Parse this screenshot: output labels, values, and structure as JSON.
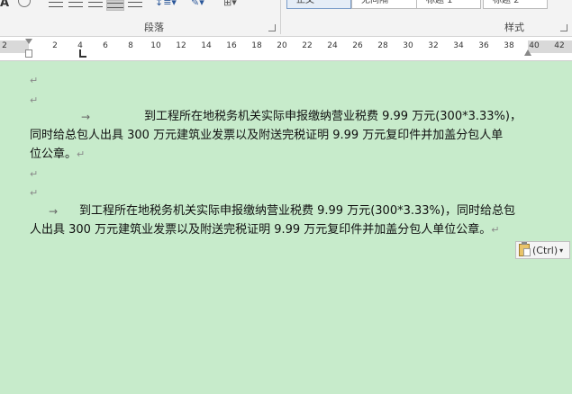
{
  "ribbon": {
    "paragraph_group_label": "段落",
    "styles_group_label": "样式",
    "style_items": [
      "正文",
      "无间隔",
      "标题 1",
      "标题 2"
    ]
  },
  "ruler": {
    "numbers": [
      "2",
      "2",
      "4",
      "6",
      "8",
      "10",
      "12",
      "14",
      "16",
      "18",
      "20",
      "22",
      "24",
      "26",
      "28",
      "30",
      "32",
      "34",
      "36",
      "38",
      "40",
      "42"
    ]
  },
  "document": {
    "paragraph_mark": "↵",
    "tab_arrow": "→",
    "para1": {
      "line1": "到工程所在地税务机关实际申报缴纳营业税费 9.99 万元(300*3.33%)，",
      "line2": "同时给总包人出具 300 万元建筑业发票以及附送完税证明 9.99 万元复印件并加盖分包人单",
      "line3": "位公章。"
    },
    "para2": {
      "line1": "到工程所在地税务机关实际申报缴纳营业税费 9.99 万元(300*3.33%)，同时给总包",
      "line2": "人出具 300 万元建筑业发票以及附送完税证明 9.99 万元复印件并加盖分包人单位公章。"
    }
  },
  "paste_options": {
    "label": "(Ctrl)"
  }
}
